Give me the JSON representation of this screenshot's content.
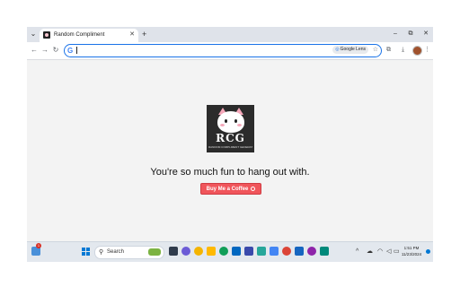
{
  "browser": {
    "tab": {
      "title": "Random Compliment",
      "close_icon": "close-icon"
    },
    "new_tab_icon": "plus-icon",
    "window_controls": {
      "minimize": "–",
      "restore": "⧉",
      "close": "✕"
    },
    "toolbar": {
      "back": "←",
      "forward": "→",
      "reload": "↻",
      "address_value": "",
      "google_icon": "G",
      "lens_label": "Google Lens",
      "extensions": "⧉",
      "download": "⤓",
      "menu": "⋮"
    }
  },
  "page": {
    "logo": {
      "mark": "RCG",
      "sub": "RANDOM COMPLIMENT GENERATOR"
    },
    "compliment_text": "You're so much fun to hang out with.",
    "coffee_button_label": "Buy Me a Coffee",
    "accent_color": "#f0555b"
  },
  "taskbar": {
    "widget_badge": "1",
    "search_placeholder": "Search",
    "clock_time": "1:51 PM",
    "clock_date": "11/23/2024",
    "tray": {
      "chevron": "^",
      "cloud": "☁",
      "wifi": "◠",
      "volume": "◁",
      "battery": "▭"
    }
  }
}
